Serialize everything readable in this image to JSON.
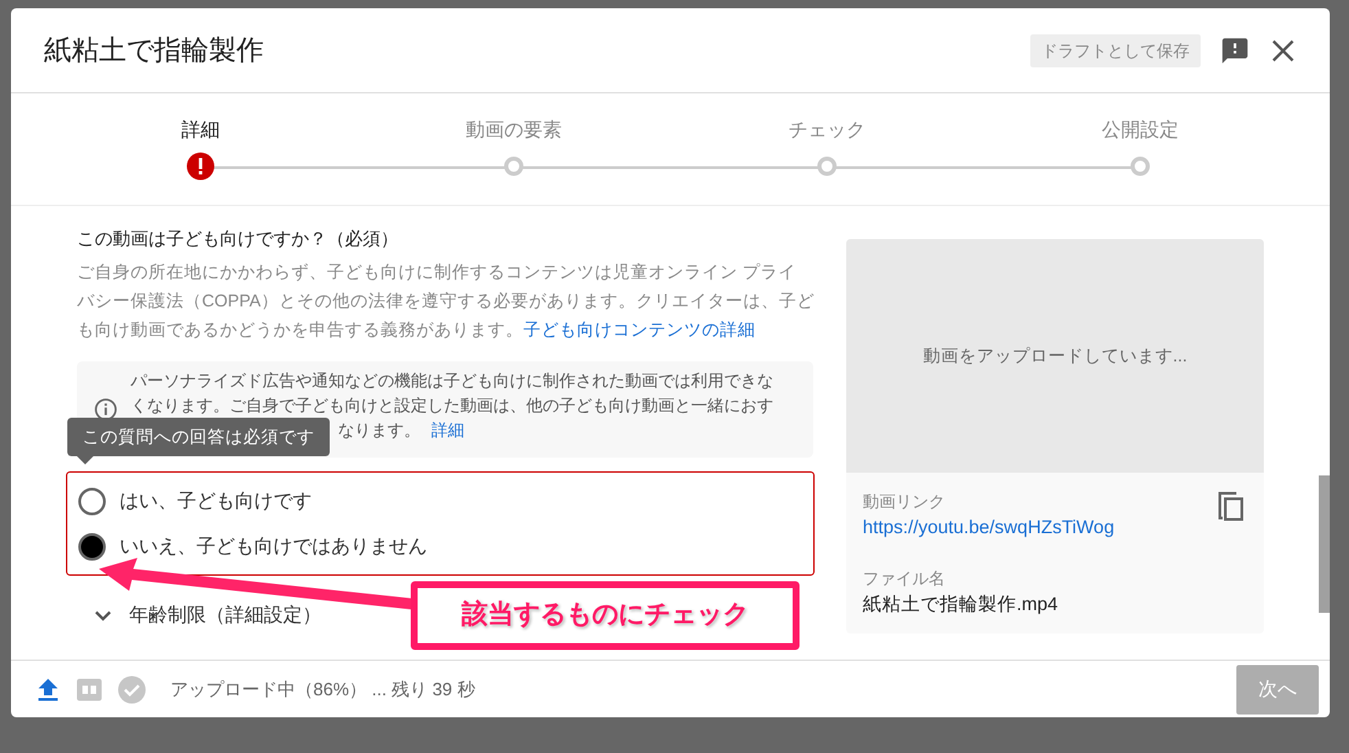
{
  "dialog": {
    "title": "紙粘土で指輪製作",
    "save_draft": "ドラフトとして保存"
  },
  "steps": [
    {
      "label": "詳細",
      "selected": true,
      "error": true
    },
    {
      "label": "動画の要素",
      "selected": false,
      "error": false
    },
    {
      "label": "チェック",
      "selected": false,
      "error": false
    },
    {
      "label": "公開設定",
      "selected": false,
      "error": false
    }
  ],
  "section": {
    "heading": "この動画は子ども向けですか？（必須）",
    "description_lines": [
      "ご自身の所在地にかかわらず、子ども向けに制作するコンテンツは児童オンライン プライ",
      "バシー保護法（COPPA）とその他の法律を遵守する必要があります。クリエイターは、子ど",
      "も向け動画であるかどうかを申告する義務があります。"
    ],
    "link": "子ども向けコンテンツの詳細"
  },
  "info": {
    "lines": [
      "パーソナライズド広告や通知などの機能は子ども向けに制作された動画では利用できな",
      "くなります。ご自身で子ども向けと設定した動画は、他の子ども向け動画と一緒におす",
      "なります。"
    ],
    "link": "詳細"
  },
  "tooltip": "この質問への回答は必須です",
  "answer_required": true,
  "options": [
    {
      "label": "はい、子ども向けです",
      "selected": false
    },
    {
      "label": "いいえ、子ども向けではありません",
      "selected": true
    }
  ],
  "age_restriction": {
    "label": "年齢制限（詳細設定）",
    "expanded": false
  },
  "preview": {
    "status": "動画をアップロードしています...",
    "link_label": "動画リンク",
    "link": "https://youtu.be/swqHZsTiWog",
    "file_label": "ファイル名",
    "file_name": "紙粘土で指輪製作.mp4"
  },
  "footer": {
    "status": "アップロード中（86%） ... 残り 39 秒",
    "next": "次へ",
    "next_disabled": true
  },
  "annotation": {
    "text": "該当するものにチェック"
  }
}
